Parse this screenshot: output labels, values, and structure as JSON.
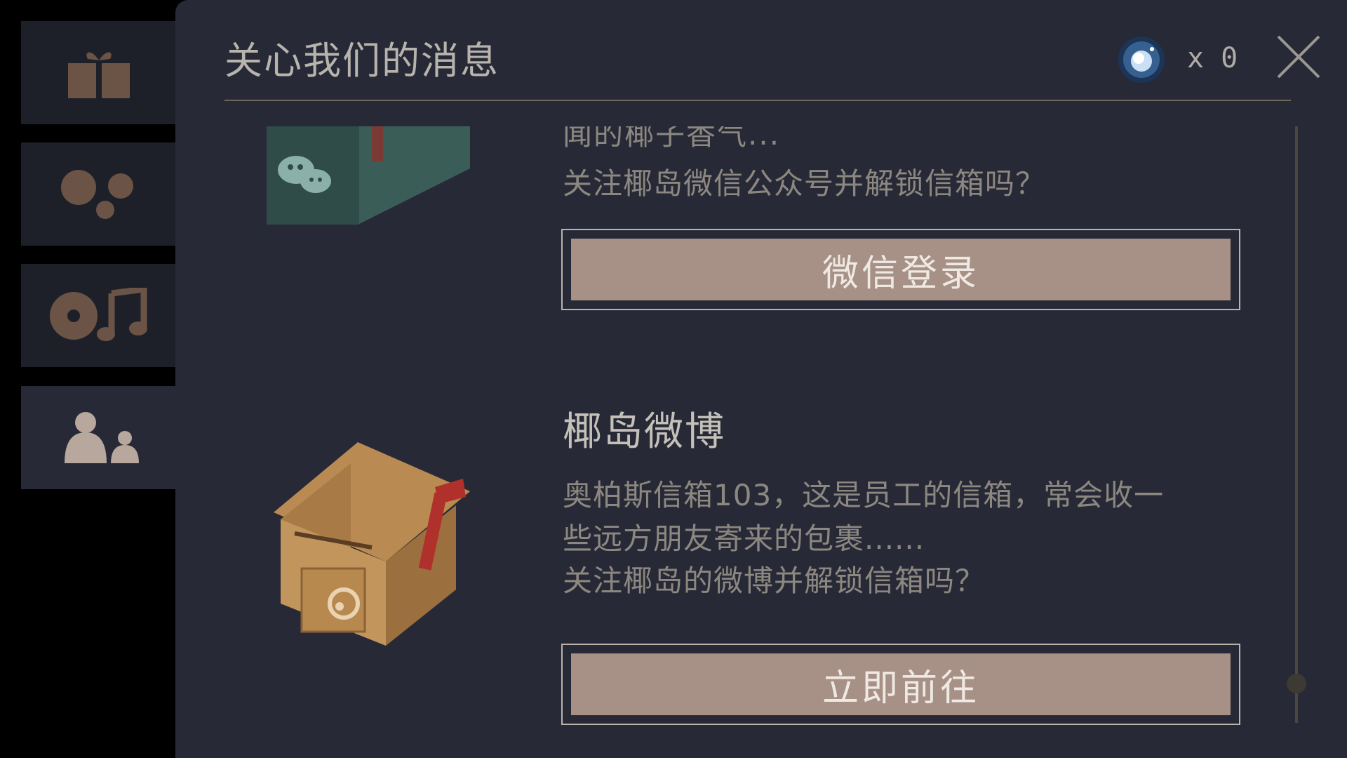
{
  "sidebar": {
    "tabs": [
      {
        "id": "gift",
        "icon": "gift-icon",
        "active": false
      },
      {
        "id": "dots",
        "icon": "dots-icon",
        "active": false
      },
      {
        "id": "music",
        "icon": "music-disc-icon",
        "active": false
      },
      {
        "id": "people",
        "icon": "people-icon",
        "active": true
      }
    ]
  },
  "header": {
    "title": "关心我们的消息",
    "currency_label": "x 0",
    "currency_icon": "orb-icon",
    "close_icon": "close-icon"
  },
  "cards": [
    {
      "cut_off_text": "闻的椰子香气...",
      "description": [
        "关注椰岛微信公众号并解锁信箱吗？"
      ],
      "button_label": "微信登录",
      "image_icon": "wechat-mailbox-icon"
    },
    {
      "title": "椰岛微博",
      "description": [
        "奥柏斯信箱103，这是员工的信箱，常会收一",
        "些远方朋友寄来的包裹......",
        "关注椰岛的微博并解锁信箱吗？"
      ],
      "button_label": "立即前往",
      "image_icon": "weibo-mailbox-icon"
    }
  ],
  "colors": {
    "panel_bg": "#272a36",
    "tab_bg": "#1e2029",
    "button_fill": "#a79086",
    "text_muted": "#8c8780",
    "icon_brown": "#6b5345"
  }
}
